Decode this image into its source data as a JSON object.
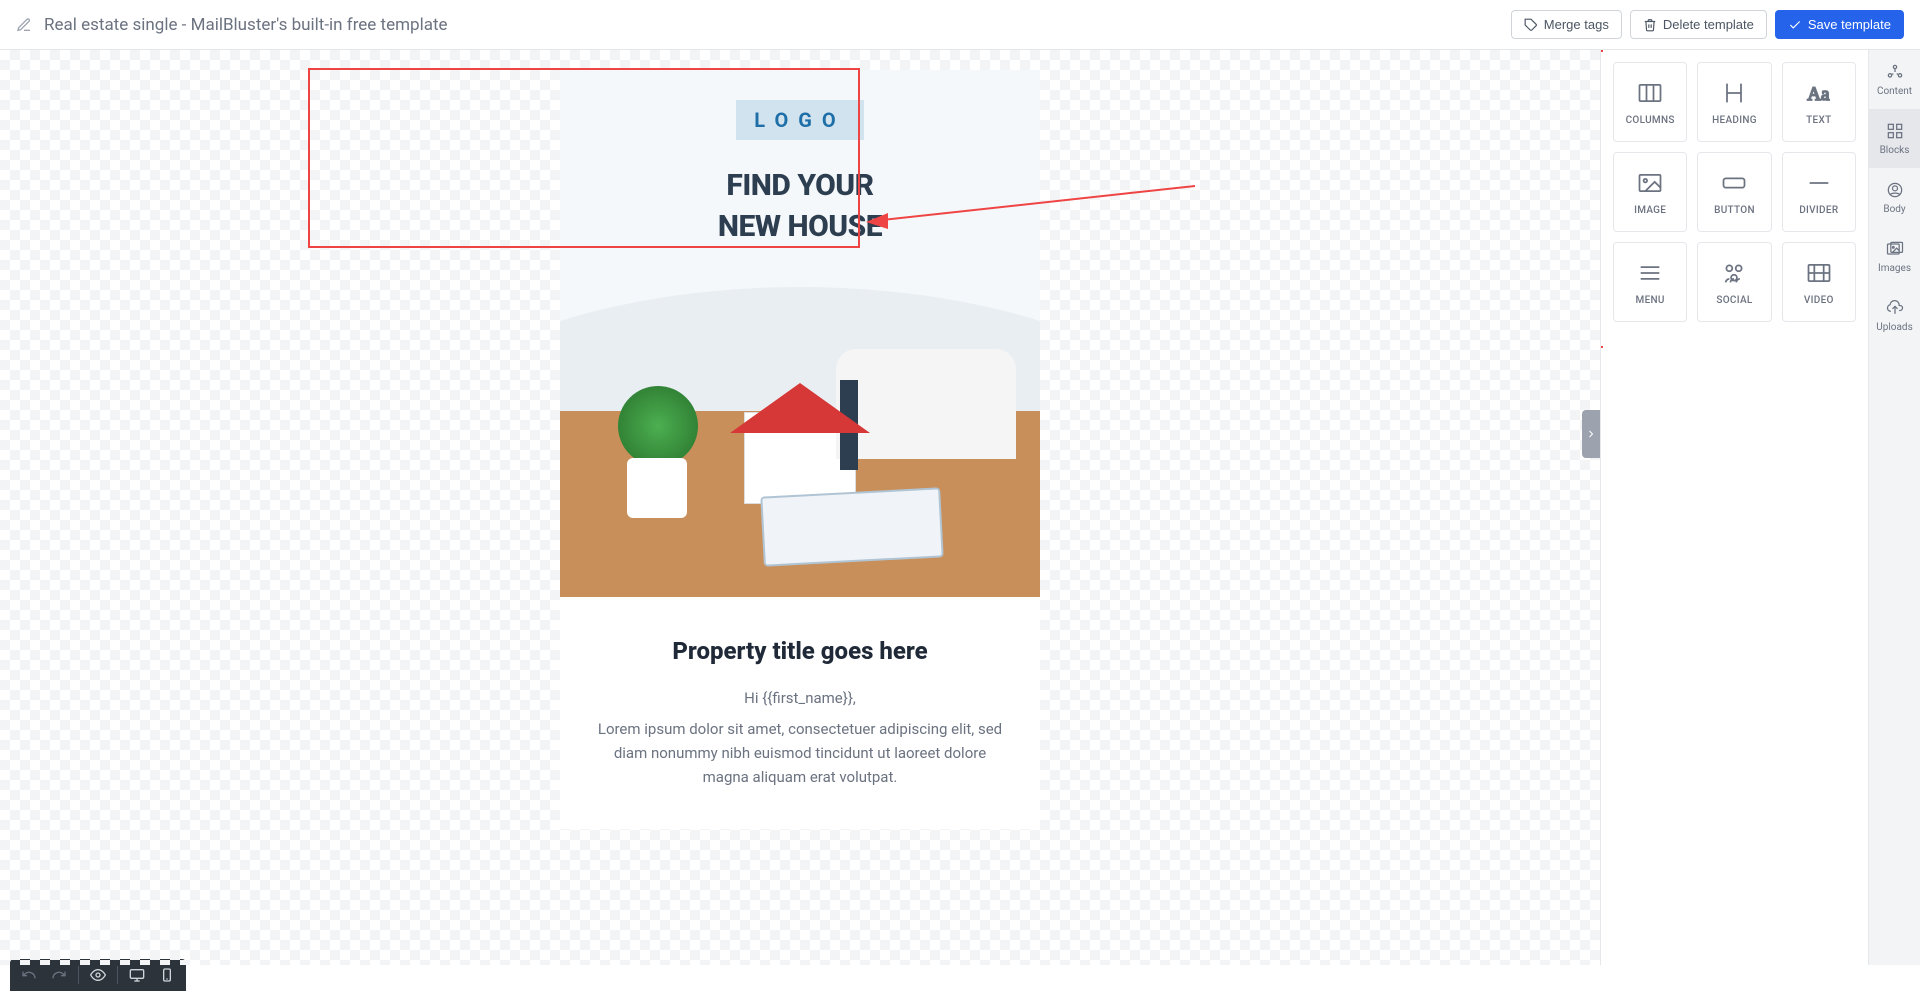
{
  "header": {
    "title": "Real estate single - MailBluster's built-in free template",
    "buttons": {
      "merge_tags": "Merge tags",
      "delete_template": "Delete template",
      "save_template": "Save template"
    }
  },
  "email": {
    "logo": "LOGO",
    "headline_line1": "FIND YOUR",
    "headline_line2": "NEW HOUSE",
    "property_title": "Property title goes here",
    "greeting": "Hi {{first_name}},",
    "body": "Lorem ipsum dolor sit amet, consectetuer adipiscing elit, sed diam nonummy nibh euismod tincidunt ut laoreet dolore magna aliquam erat volutpat."
  },
  "blocks": [
    {
      "name": "columns",
      "label": "COLUMNS"
    },
    {
      "name": "heading",
      "label": "HEADING"
    },
    {
      "name": "text",
      "label": "TEXT"
    },
    {
      "name": "image",
      "label": "IMAGE"
    },
    {
      "name": "button",
      "label": "BUTTON"
    },
    {
      "name": "divider",
      "label": "DIVIDER"
    },
    {
      "name": "menu",
      "label": "MENU"
    },
    {
      "name": "social",
      "label": "SOCIAL"
    },
    {
      "name": "video",
      "label": "VIDEO"
    }
  ],
  "tabs": [
    {
      "name": "content",
      "label": "Content"
    },
    {
      "name": "blocks",
      "label": "Blocks"
    },
    {
      "name": "body",
      "label": "Body"
    },
    {
      "name": "images",
      "label": "Images"
    },
    {
      "name": "uploads",
      "label": "Uploads"
    }
  ],
  "active_tab": "blocks"
}
